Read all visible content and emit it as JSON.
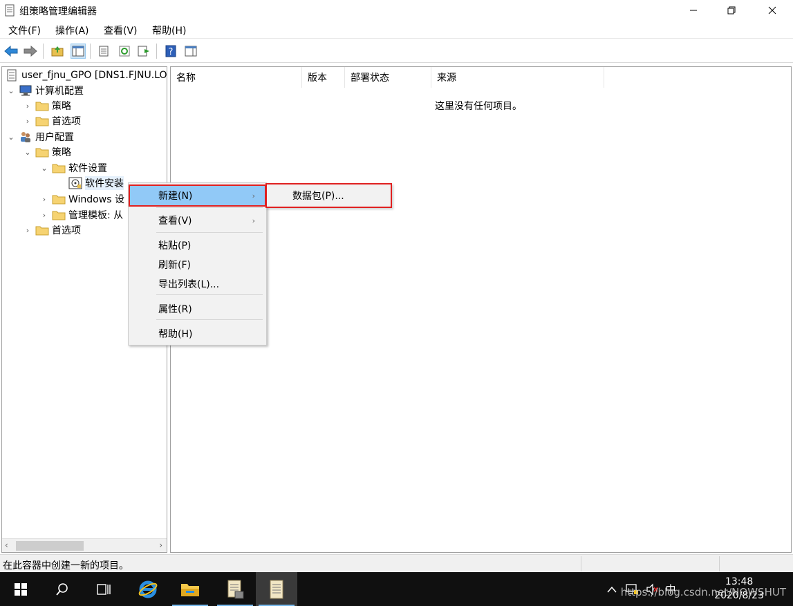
{
  "window": {
    "title": "组策略管理编辑器"
  },
  "menubar": {
    "items": [
      "文件(F)",
      "操作(A)",
      "查看(V)",
      "帮助(H)"
    ]
  },
  "toolbar": {
    "icons": [
      "back-arrow-icon",
      "forward-arrow-icon",
      "up-folder-icon",
      "show-hide-tree-icon",
      "properties-icon",
      "refresh-icon",
      "export-list-icon",
      "help-icon",
      "show-action-pane-icon"
    ]
  },
  "tree": {
    "root": "user_fjnu_GPO [DNS1.FJNU.LO",
    "computer_config": "计算机配置",
    "cc_policies": "策略",
    "cc_preferences": "首选项",
    "user_config": "用户配置",
    "uc_policies": "策略",
    "software_settings": "软件设置",
    "software_install": "软件安装",
    "windows_settings": "Windows 设",
    "admin_templates": "管理模板: 从",
    "uc_preferences": "首选项"
  },
  "list": {
    "columns": [
      "名称",
      "版本",
      "部署状态",
      "来源"
    ],
    "empty_message": "这里没有任何项目。"
  },
  "context_menu": {
    "new": "新建(N)",
    "view": "查看(V)",
    "paste": "粘贴(P)",
    "refresh": "刷新(F)",
    "export": "导出列表(L)...",
    "properties": "属性(R)",
    "help": "帮助(H)"
  },
  "submenu": {
    "package": "数据包(P)..."
  },
  "statusbar": {
    "text": "在此容器中创建一新的项目。"
  },
  "taskbar": {
    "time": "13:48",
    "date": "2020/8/23",
    "ime": "中",
    "watermark": "https://blog.csdn.net/NOWSHUT"
  },
  "colors": {
    "highlight": "#91c9f7",
    "annotation_red": "#e02020",
    "taskbar": "#101010"
  }
}
